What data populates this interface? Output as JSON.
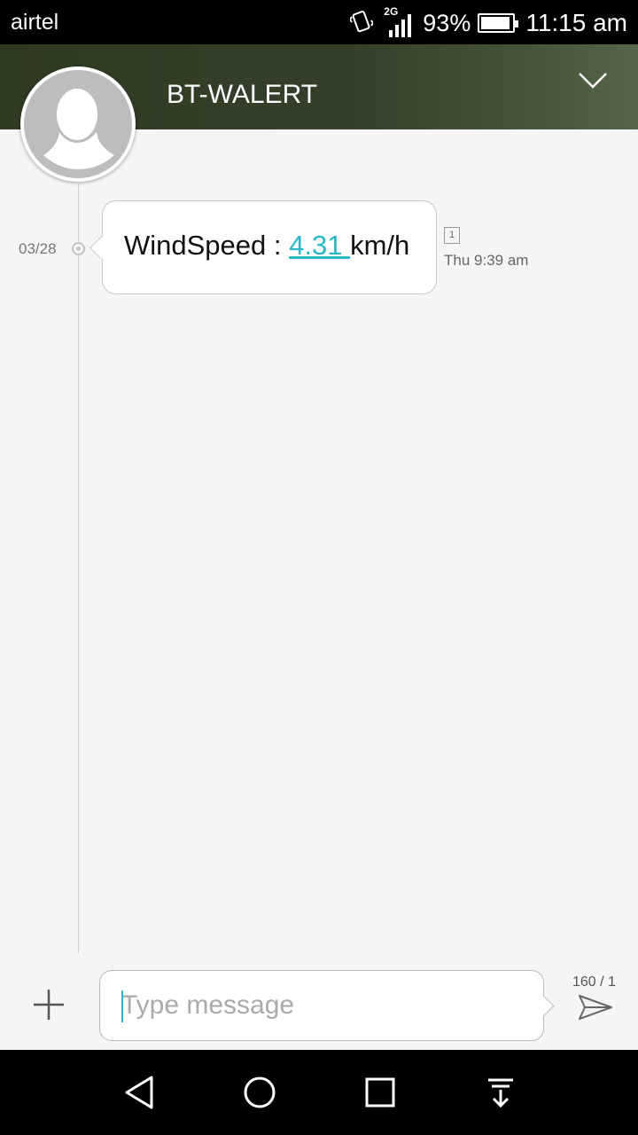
{
  "status_bar": {
    "carrier": "airtel",
    "network_type": "2G",
    "battery_percent": "93%",
    "battery_level": 0.93,
    "time": "11:15 am",
    "icons": [
      "vibrate-icon",
      "signal-icon",
      "battery-icon"
    ]
  },
  "header": {
    "contact_name": "BT-WALERT",
    "icons": [
      "avatar",
      "chevron-down-icon"
    ]
  },
  "conversation": {
    "date": "03/28",
    "messages": [
      {
        "text_before": "WindSpeed : ",
        "link_text": "4.31 ",
        "text_after": "km/h",
        "sim": "1",
        "time": "Thu 9:39 am"
      }
    ]
  },
  "compose": {
    "placeholder": "Type message",
    "value": "",
    "char_counter": "160 / 1",
    "icons": [
      "plus-icon",
      "send-icon"
    ]
  },
  "nav_bar": {
    "icons": [
      "back-icon",
      "home-icon",
      "recents-icon",
      "notifications-icon"
    ]
  },
  "colors": {
    "accent": "#2ab7c8",
    "header_bg": "#34402a",
    "background": "#f5f5f5"
  }
}
